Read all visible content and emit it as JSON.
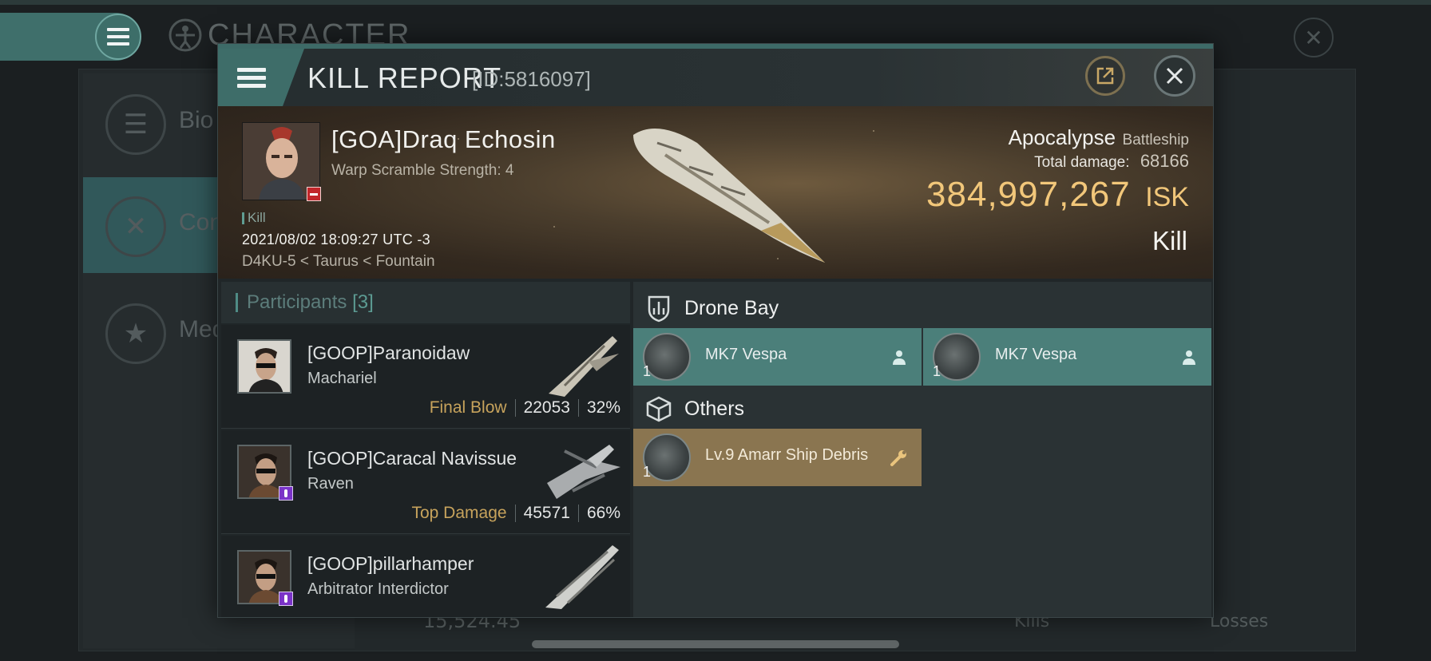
{
  "background": {
    "title": "CHARACTER",
    "sidebar": [
      {
        "label": "Bio",
        "icon": "list-icon"
      },
      {
        "label": "Con",
        "icon": "crossed-swords-icon"
      },
      {
        "label": "Med",
        "icon": "star-badge-icon"
      }
    ],
    "bottom": {
      "value": "15,524.45",
      "kills_label": "Kills",
      "losses_label": "Losses"
    }
  },
  "report": {
    "title": "KILL REPORT",
    "id": "[ID:5816097]",
    "victim": {
      "name": "[GOA]Draq Echosin",
      "warp_scramble": "Warp Scramble Strength: 4",
      "tag": "Kill",
      "datetime": "2021/08/02 18:09:27 UTC -3",
      "location": "D4KU-5 < Taurus < Fountain"
    },
    "ship": {
      "name": "Apocalypse",
      "class": "Battleship",
      "total_damage_label": "Total damage:",
      "total_damage": "68166",
      "isk_value": "384,997,267",
      "isk_unit": "ISK",
      "result": "Kill"
    },
    "colors": {
      "accent": "#3e6d69",
      "isk": "#f2c77a",
      "gold_tag": "#c7a35c"
    }
  },
  "participants": {
    "label": "Participants",
    "count": "[3]",
    "rows": [
      {
        "name": "[GOOP]Paranoidaw",
        "ship": "Machariel",
        "tag": "Final Blow",
        "damage": "22053",
        "percent": "32%"
      },
      {
        "name": "[GOOP]Caracal Navissue",
        "ship": "Raven",
        "tag": "Top Damage",
        "damage": "45571",
        "percent": "66%"
      },
      {
        "name": "[GOOP]pillarhamper",
        "ship": "Arbitrator Interdictor"
      }
    ]
  },
  "cargo": {
    "drone_bay": {
      "label": "Drone Bay",
      "items": [
        {
          "name": "MK7 Vespa",
          "qty": "1"
        },
        {
          "name": "MK7 Vespa",
          "qty": "1"
        }
      ]
    },
    "others": {
      "label": "Others",
      "items": [
        {
          "name": "Lv.9 Amarr Ship Debris",
          "qty": "1"
        }
      ]
    }
  }
}
